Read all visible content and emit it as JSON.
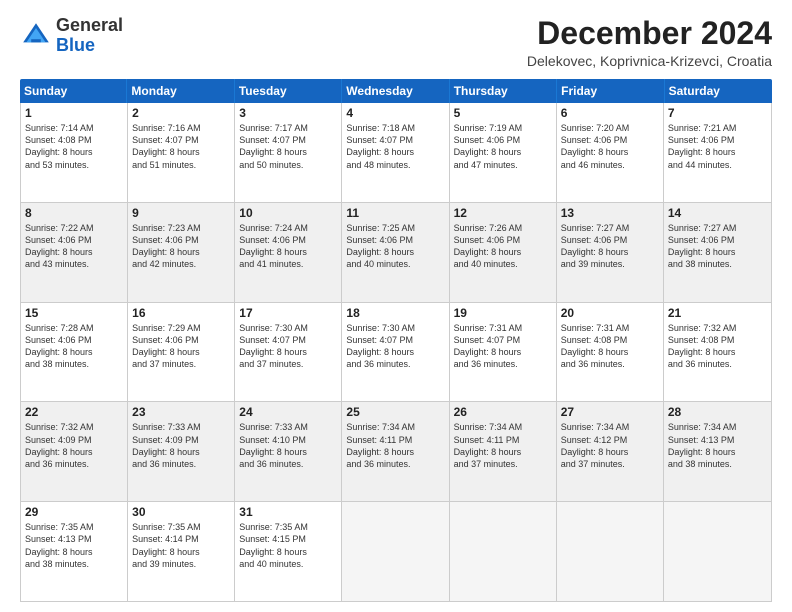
{
  "logo": {
    "general": "General",
    "blue": "Blue"
  },
  "header": {
    "month": "December 2024",
    "location": "Delekovec, Koprivnica-Krizevci, Croatia"
  },
  "weekdays": [
    "Sunday",
    "Monday",
    "Tuesday",
    "Wednesday",
    "Thursday",
    "Friday",
    "Saturday"
  ],
  "weeks": [
    [
      {
        "day": "1",
        "lines": [
          "Sunrise: 7:14 AM",
          "Sunset: 4:08 PM",
          "Daylight: 8 hours",
          "and 53 minutes."
        ],
        "shaded": false
      },
      {
        "day": "2",
        "lines": [
          "Sunrise: 7:16 AM",
          "Sunset: 4:07 PM",
          "Daylight: 8 hours",
          "and 51 minutes."
        ],
        "shaded": false
      },
      {
        "day": "3",
        "lines": [
          "Sunrise: 7:17 AM",
          "Sunset: 4:07 PM",
          "Daylight: 8 hours",
          "and 50 minutes."
        ],
        "shaded": false
      },
      {
        "day": "4",
        "lines": [
          "Sunrise: 7:18 AM",
          "Sunset: 4:07 PM",
          "Daylight: 8 hours",
          "and 48 minutes."
        ],
        "shaded": false
      },
      {
        "day": "5",
        "lines": [
          "Sunrise: 7:19 AM",
          "Sunset: 4:06 PM",
          "Daylight: 8 hours",
          "and 47 minutes."
        ],
        "shaded": false
      },
      {
        "day": "6",
        "lines": [
          "Sunrise: 7:20 AM",
          "Sunset: 4:06 PM",
          "Daylight: 8 hours",
          "and 46 minutes."
        ],
        "shaded": false
      },
      {
        "day": "7",
        "lines": [
          "Sunrise: 7:21 AM",
          "Sunset: 4:06 PM",
          "Daylight: 8 hours",
          "and 44 minutes."
        ],
        "shaded": false
      }
    ],
    [
      {
        "day": "8",
        "lines": [
          "Sunrise: 7:22 AM",
          "Sunset: 4:06 PM",
          "Daylight: 8 hours",
          "and 43 minutes."
        ],
        "shaded": true
      },
      {
        "day": "9",
        "lines": [
          "Sunrise: 7:23 AM",
          "Sunset: 4:06 PM",
          "Daylight: 8 hours",
          "and 42 minutes."
        ],
        "shaded": true
      },
      {
        "day": "10",
        "lines": [
          "Sunrise: 7:24 AM",
          "Sunset: 4:06 PM",
          "Daylight: 8 hours",
          "and 41 minutes."
        ],
        "shaded": true
      },
      {
        "day": "11",
        "lines": [
          "Sunrise: 7:25 AM",
          "Sunset: 4:06 PM",
          "Daylight: 8 hours",
          "and 40 minutes."
        ],
        "shaded": true
      },
      {
        "day": "12",
        "lines": [
          "Sunrise: 7:26 AM",
          "Sunset: 4:06 PM",
          "Daylight: 8 hours",
          "and 40 minutes."
        ],
        "shaded": true
      },
      {
        "day": "13",
        "lines": [
          "Sunrise: 7:27 AM",
          "Sunset: 4:06 PM",
          "Daylight: 8 hours",
          "and 39 minutes."
        ],
        "shaded": true
      },
      {
        "day": "14",
        "lines": [
          "Sunrise: 7:27 AM",
          "Sunset: 4:06 PM",
          "Daylight: 8 hours",
          "and 38 minutes."
        ],
        "shaded": true
      }
    ],
    [
      {
        "day": "15",
        "lines": [
          "Sunrise: 7:28 AM",
          "Sunset: 4:06 PM",
          "Daylight: 8 hours",
          "and 38 minutes."
        ],
        "shaded": false
      },
      {
        "day": "16",
        "lines": [
          "Sunrise: 7:29 AM",
          "Sunset: 4:06 PM",
          "Daylight: 8 hours",
          "and 37 minutes."
        ],
        "shaded": false
      },
      {
        "day": "17",
        "lines": [
          "Sunrise: 7:30 AM",
          "Sunset: 4:07 PM",
          "Daylight: 8 hours",
          "and 37 minutes."
        ],
        "shaded": false
      },
      {
        "day": "18",
        "lines": [
          "Sunrise: 7:30 AM",
          "Sunset: 4:07 PM",
          "Daylight: 8 hours",
          "and 36 minutes."
        ],
        "shaded": false
      },
      {
        "day": "19",
        "lines": [
          "Sunrise: 7:31 AM",
          "Sunset: 4:07 PM",
          "Daylight: 8 hours",
          "and 36 minutes."
        ],
        "shaded": false
      },
      {
        "day": "20",
        "lines": [
          "Sunrise: 7:31 AM",
          "Sunset: 4:08 PM",
          "Daylight: 8 hours",
          "and 36 minutes."
        ],
        "shaded": false
      },
      {
        "day": "21",
        "lines": [
          "Sunrise: 7:32 AM",
          "Sunset: 4:08 PM",
          "Daylight: 8 hours",
          "and 36 minutes."
        ],
        "shaded": false
      }
    ],
    [
      {
        "day": "22",
        "lines": [
          "Sunrise: 7:32 AM",
          "Sunset: 4:09 PM",
          "Daylight: 8 hours",
          "and 36 minutes."
        ],
        "shaded": true
      },
      {
        "day": "23",
        "lines": [
          "Sunrise: 7:33 AM",
          "Sunset: 4:09 PM",
          "Daylight: 8 hours",
          "and 36 minutes."
        ],
        "shaded": true
      },
      {
        "day": "24",
        "lines": [
          "Sunrise: 7:33 AM",
          "Sunset: 4:10 PM",
          "Daylight: 8 hours",
          "and 36 minutes."
        ],
        "shaded": true
      },
      {
        "day": "25",
        "lines": [
          "Sunrise: 7:34 AM",
          "Sunset: 4:11 PM",
          "Daylight: 8 hours",
          "and 36 minutes."
        ],
        "shaded": true
      },
      {
        "day": "26",
        "lines": [
          "Sunrise: 7:34 AM",
          "Sunset: 4:11 PM",
          "Daylight: 8 hours",
          "and 37 minutes."
        ],
        "shaded": true
      },
      {
        "day": "27",
        "lines": [
          "Sunrise: 7:34 AM",
          "Sunset: 4:12 PM",
          "Daylight: 8 hours",
          "and 37 minutes."
        ],
        "shaded": true
      },
      {
        "day": "28",
        "lines": [
          "Sunrise: 7:34 AM",
          "Sunset: 4:13 PM",
          "Daylight: 8 hours",
          "and 38 minutes."
        ],
        "shaded": true
      }
    ],
    [
      {
        "day": "29",
        "lines": [
          "Sunrise: 7:35 AM",
          "Sunset: 4:13 PM",
          "Daylight: 8 hours",
          "and 38 minutes."
        ],
        "shaded": false
      },
      {
        "day": "30",
        "lines": [
          "Sunrise: 7:35 AM",
          "Sunset: 4:14 PM",
          "Daylight: 8 hours",
          "and 39 minutes."
        ],
        "shaded": false
      },
      {
        "day": "31",
        "lines": [
          "Sunrise: 7:35 AM",
          "Sunset: 4:15 PM",
          "Daylight: 8 hours",
          "and 40 minutes."
        ],
        "shaded": false
      },
      {
        "day": "",
        "lines": [],
        "shaded": true,
        "empty": true
      },
      {
        "day": "",
        "lines": [],
        "shaded": true,
        "empty": true
      },
      {
        "day": "",
        "lines": [],
        "shaded": true,
        "empty": true
      },
      {
        "day": "",
        "lines": [],
        "shaded": true,
        "empty": true
      }
    ]
  ]
}
